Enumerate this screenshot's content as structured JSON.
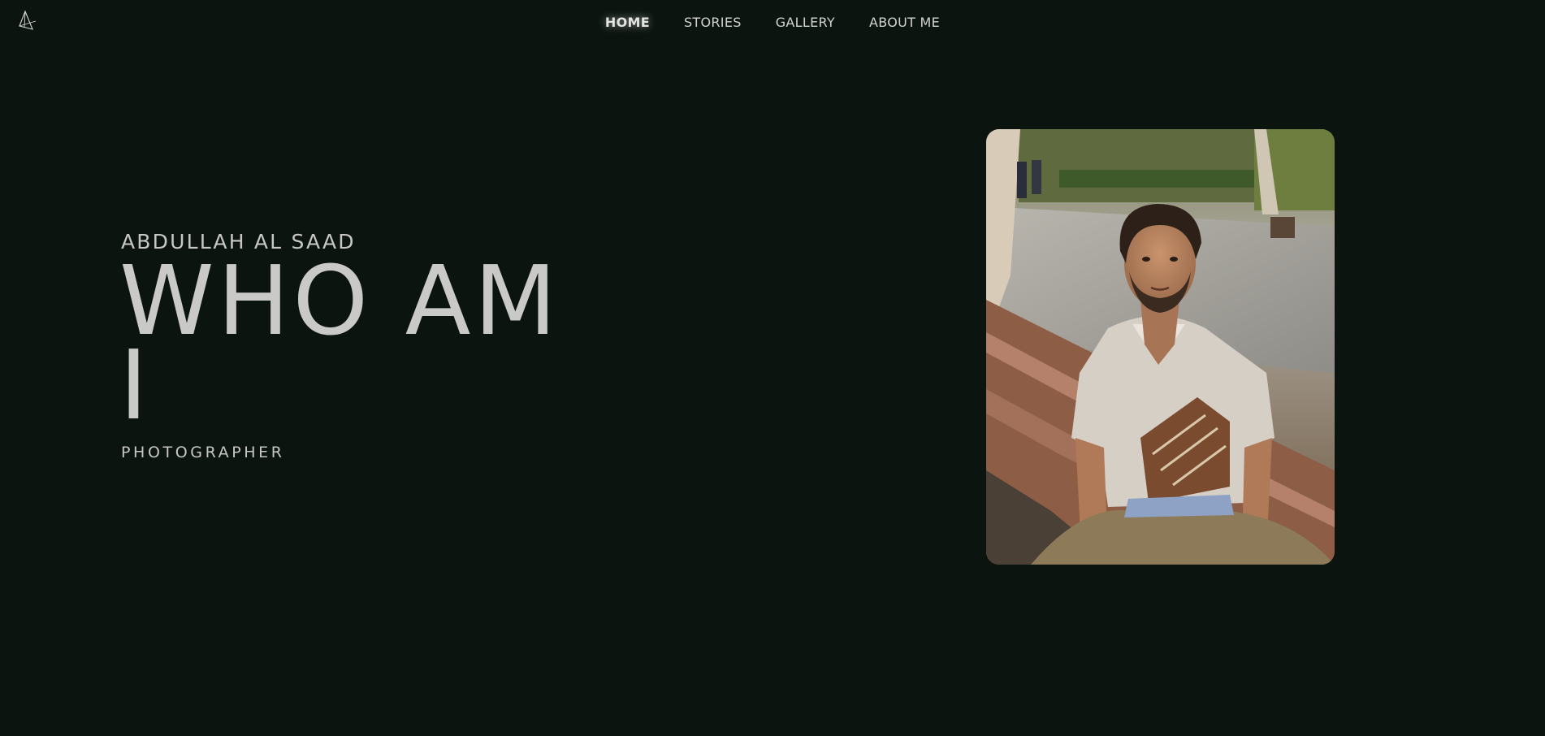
{
  "header": {
    "logo_icon": "triangle-logo-icon",
    "nav": [
      {
        "label": "HOME",
        "active": true
      },
      {
        "label": "STORIES",
        "active": false
      },
      {
        "label": "GALLERY",
        "active": false
      },
      {
        "label": "ABOUT ME",
        "active": false
      }
    ]
  },
  "hero": {
    "name": "ABDULLAH AL SAAD",
    "headline": "WHO AM I",
    "role": "PHOTOGRAPHER",
    "portrait": "portrait-photo"
  },
  "colors": {
    "background": "#0c1410",
    "text": "#c9cac8",
    "nav_text": "#d2d4d1"
  }
}
